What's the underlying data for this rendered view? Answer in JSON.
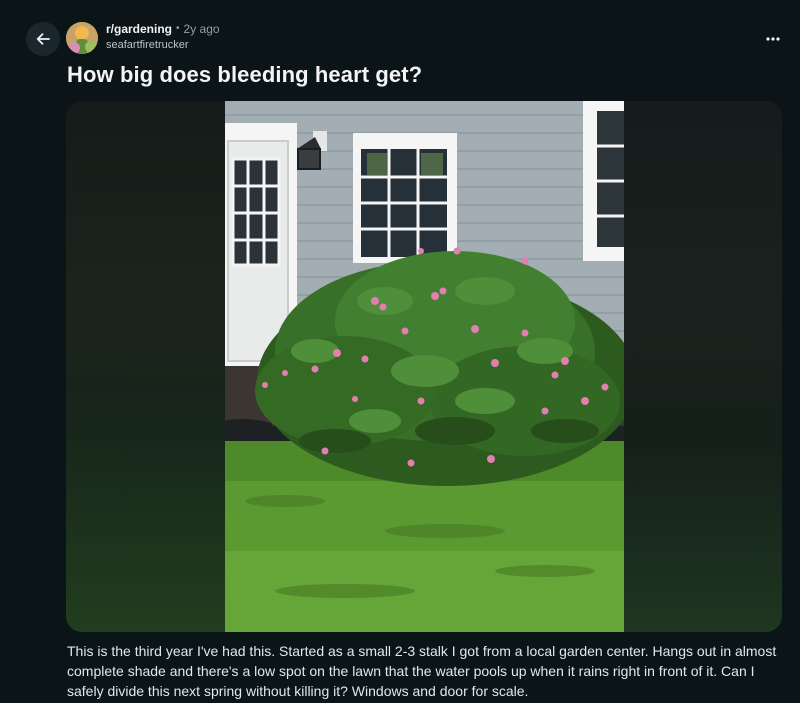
{
  "header": {
    "subreddit": "r/gardening",
    "separator": "•",
    "age": "2y ago",
    "author": "seafartfiretrucker"
  },
  "icons": {
    "back": "arrow-left-icon",
    "more": "ellipsis-horizontal-icon"
  },
  "post": {
    "title": "How big does bleeding heart get?",
    "body": "This is the third year I've had this. Started as a small 2-3 stalk I got from a local garden center. Hangs out in almost complete shade and there's a low spot on the lawn that the water pools up when it rains right in front of it. Can I safely divide this next spring without killing it? Windows and door for scale."
  },
  "colors": {
    "background": "#0b1416",
    "text": "#f2f4f5",
    "muted": "#8ba2ad"
  }
}
